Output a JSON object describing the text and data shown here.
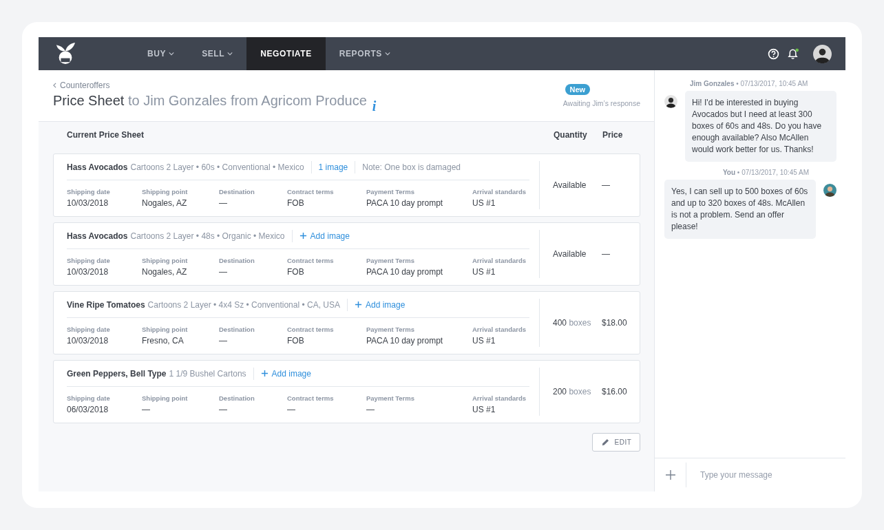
{
  "nav": {
    "tabs": [
      {
        "label": "BUY",
        "dropdown": true,
        "selected": false
      },
      {
        "label": "SELL",
        "dropdown": true,
        "selected": false
      },
      {
        "label": "NEGOTIATE",
        "dropdown": false,
        "selected": true
      },
      {
        "label": "REPORTS",
        "dropdown": true,
        "selected": false
      }
    ],
    "notifications_unread": true
  },
  "header": {
    "back": "Counteroffers",
    "title": "Price Sheet",
    "subtitle": "to Jim Gonzales from Agricom Produce",
    "info": "i",
    "badge": "New",
    "status": "Awaiting Jim’s response"
  },
  "table": {
    "columns": [
      "Current Price Sheet",
      "Quantity",
      "Price"
    ],
    "items": [
      {
        "name": "Hass Avocados",
        "description": "Cartoons 2 Layer • 60s • Conventional • Mexico",
        "link": {
          "kind": "link",
          "label": "1 image"
        },
        "note": "Note: One box is damaged",
        "fields": [
          {
            "label": "Shipping date",
            "value": "10/03/2018"
          },
          {
            "label": "Shipping point",
            "value": "Nogales, AZ"
          },
          {
            "label": "Destination",
            "value": "—"
          },
          {
            "label": "Contract terms",
            "value": "FOB"
          },
          {
            "label": "Payment Terms",
            "value": "PACA 10 day prompt"
          },
          {
            "label": "Arrival standards",
            "value": "US #1"
          }
        ],
        "quantity": {
          "value": "Available"
        },
        "price": "—"
      },
      {
        "name": "Hass Avocados",
        "description": "Cartoons 2 Layer • 48s • Organic • Mexico",
        "link": {
          "kind": "add",
          "label": "Add image"
        },
        "fields": [
          {
            "label": "Shipping date",
            "value": "10/03/2018"
          },
          {
            "label": "Shipping point",
            "value": "Nogales, AZ"
          },
          {
            "label": "Destination",
            "value": "—"
          },
          {
            "label": "Contract terms",
            "value": "FOB"
          },
          {
            "label": "Payment Terms",
            "value": "PACA 10 day prompt"
          },
          {
            "label": "Arrival standards",
            "value": "US #1"
          }
        ],
        "quantity": {
          "value": "Available"
        },
        "price": "—"
      },
      {
        "name": "Vine Ripe Tomatoes",
        "description": "Cartoons 2 Layer • 4x4 Sz • Conventional • CA, USA",
        "link": {
          "kind": "add",
          "label": "Add image"
        },
        "fields": [
          {
            "label": "Shipping date",
            "value": "10/03/2018"
          },
          {
            "label": "Shipping point",
            "value": "Fresno, CA"
          },
          {
            "label": "Destination",
            "value": "—"
          },
          {
            "label": "Contract terms",
            "value": "FOB"
          },
          {
            "label": "Payment Terms",
            "value": "PACA 10 day prompt"
          },
          {
            "label": "Arrival standards",
            "value": "US #1"
          }
        ],
        "quantity": {
          "value": "400",
          "unit": "boxes"
        },
        "price": "$18.00"
      },
      {
        "name": "Green Peppers, Bell Type",
        "description": "1 1/9 Bushel Cartons",
        "link": {
          "kind": "add",
          "label": "Add image"
        },
        "fields": [
          {
            "label": "Shipping date",
            "value": "06/03/2018"
          },
          {
            "label": "Shipping point",
            "value": "—"
          },
          {
            "label": "Destination",
            "value": "—"
          },
          {
            "label": "Contract terms",
            "value": "—"
          },
          {
            "label": "Payment Terms",
            "value": "—"
          },
          {
            "label": "Arrival standards",
            "value": "US #1"
          }
        ],
        "quantity": {
          "value": "200",
          "unit": "boxes"
        },
        "price": "$16.00"
      }
    ],
    "edit_button": "EDIT"
  },
  "chat": {
    "messages": [
      {
        "kind": "incoming",
        "sender": "Jim Gonzales",
        "time": "• 07/13/2017, 10:45 AM",
        "text": "Hi! I'd be interested in buying Avocados but I need at least 300 boxes of 60s and 48s. Do you have enough available? Also McAllen would work better for us. Thanks!"
      },
      {
        "kind": "outgoing",
        "sender": "You",
        "time": "• 07/13/2017, 10:45 AM",
        "text": "Yes, I can sell up to 500 boxes of 60s and up to 320 boxes of 48s. McAllen is not a problem. Send an offer please!"
      }
    ],
    "input": {
      "placeholder": "Type your message"
    }
  }
}
